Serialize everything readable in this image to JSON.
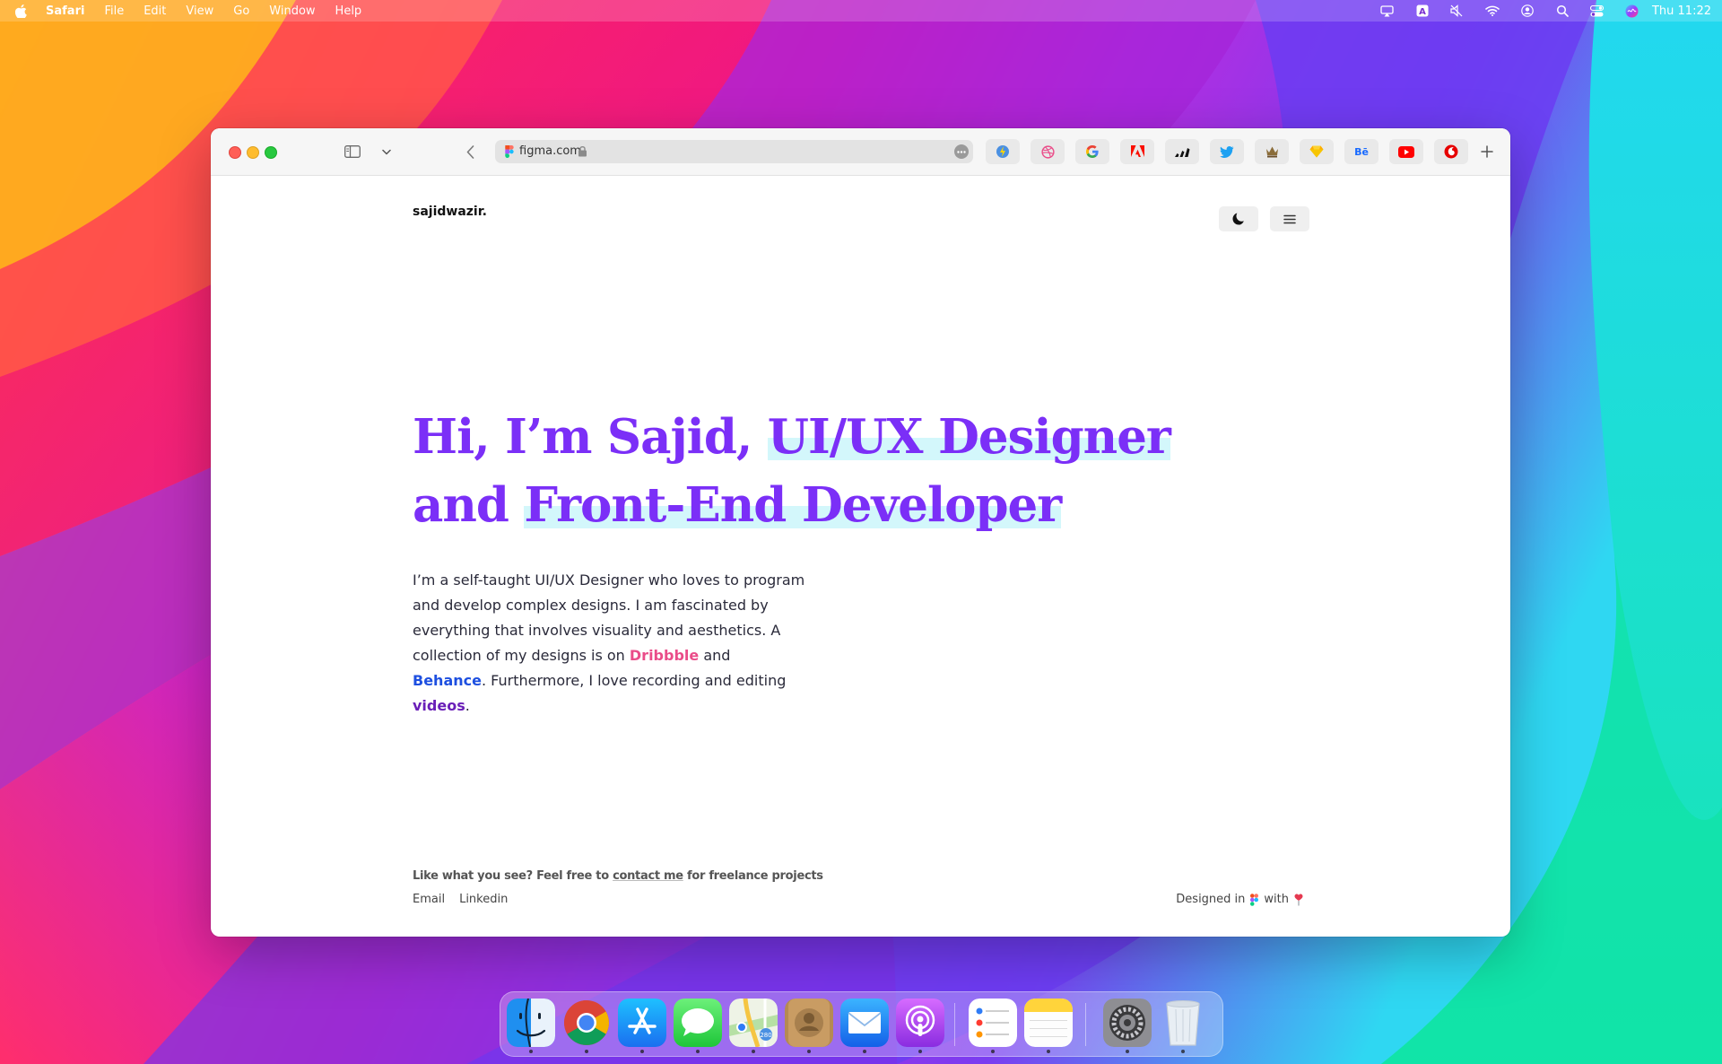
{
  "menubar": {
    "app_name": "Safari",
    "menus": [
      "File",
      "Edit",
      "View",
      "Go",
      "Window",
      "Help"
    ],
    "clock": "Thu 11:22",
    "status_icons": [
      "airplay-icon",
      "input-source-icon",
      "mute-icon",
      "wifi-icon",
      "user-icon",
      "spotlight-icon",
      "control-center-icon",
      "siri-icon"
    ]
  },
  "browser": {
    "url": "figma.com",
    "favorites": [
      {
        "name": "bookmark-1",
        "glyph": "⚡",
        "color": "#ffcc00"
      },
      {
        "name": "dribbble",
        "glyph": "◎",
        "color": "#ea4c89"
      },
      {
        "name": "google",
        "glyph": "G",
        "color": "#4285f4"
      },
      {
        "name": "adobe",
        "glyph": "A",
        "color": "#fa0f00"
      },
      {
        "name": "adidas",
        "glyph": "▲",
        "color": "#111111"
      },
      {
        "name": "twitter",
        "glyph": "🐦",
        "color": "#1da1f2"
      },
      {
        "name": "crown",
        "glyph": "♛",
        "color": "#6b4f2a"
      },
      {
        "name": "sketch",
        "glyph": "◆",
        "color": "#f7b500"
      },
      {
        "name": "behance",
        "glyph": "Bē",
        "color": "#1769ff"
      },
      {
        "name": "youtube",
        "glyph": "▶",
        "color": "#ff0000"
      },
      {
        "name": "vodafone",
        "glyph": "◐",
        "color": "#e60000"
      }
    ]
  },
  "site": {
    "logo": "sajidwazir.",
    "headline": {
      "line1_plain": "Hi, I’m Sajid, ",
      "line1_highlight": "UI/UX Designer",
      "line2_plain": "and ",
      "line2_highlight": "Front-End Developer"
    },
    "intro": {
      "text1": "I’m a self-taught UI/UX Designer who loves to program and develop complex designs. I am fascinated by everything that involves visuality and aesthetics. A collection of my designs is on ",
      "link_dribbble": "Dribbble",
      "text2": " and ",
      "link_behance": "Behance",
      "text3": ". Furthermore, I love recording and editing ",
      "link_videos": "videos",
      "text4": "."
    },
    "footer": {
      "cta_prefix": "Like what you see? Feel free to ",
      "cta_link": "contact me",
      "cta_suffix": " for freelance projects",
      "links": [
        "Email",
        "Linkedin"
      ],
      "credit_prefix": "Designed in",
      "credit_middle": "with"
    },
    "colors": {
      "accent": "#7b2ff7",
      "highlight": "#d3f7fb",
      "dribbble": "#ea4c89",
      "behance": "#1d4fe0"
    }
  },
  "dock": {
    "apps": [
      "Finder",
      "Chrome",
      "App Store",
      "Messages",
      "Maps",
      "Contacts",
      "Mail",
      "Podcasts",
      "Reminders",
      "Notes",
      "System Preferences",
      "Trash"
    ]
  }
}
